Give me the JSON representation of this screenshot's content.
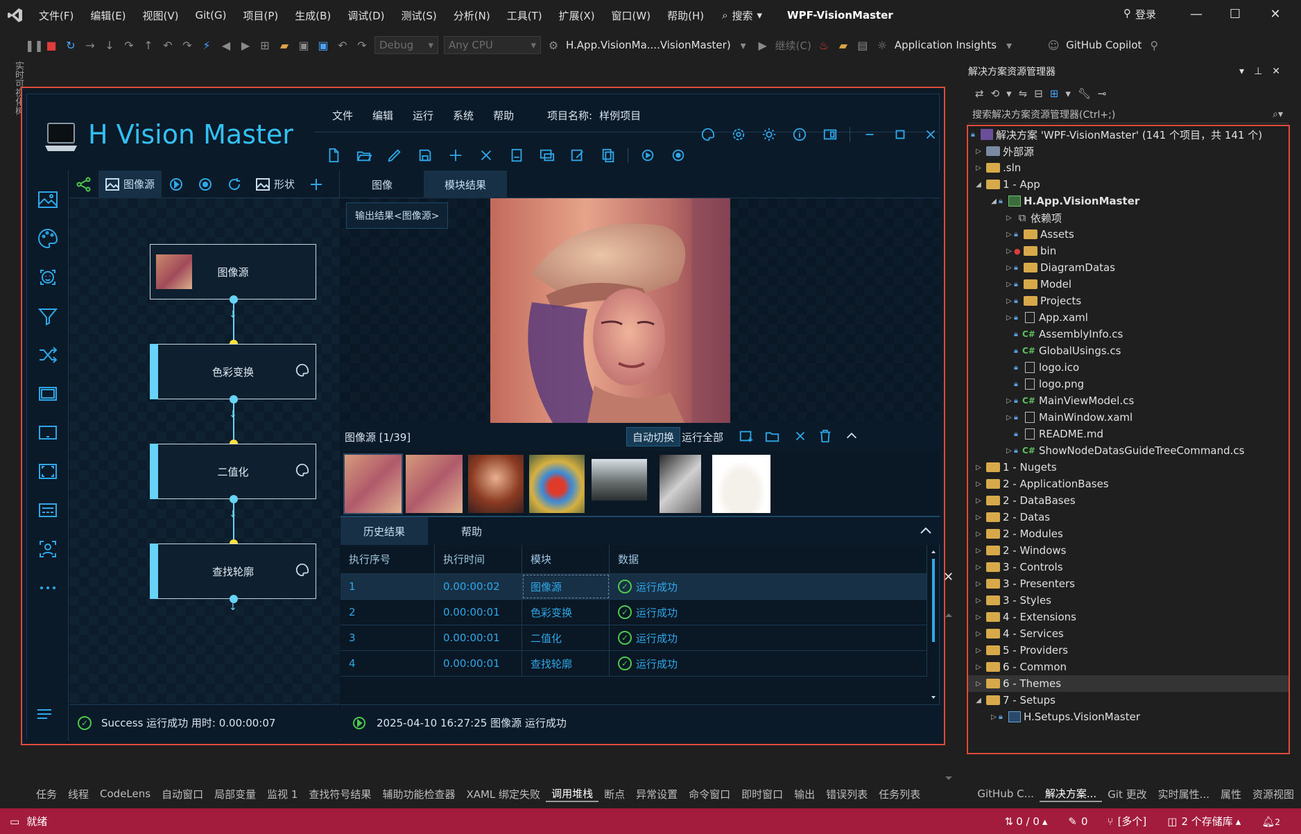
{
  "vs": {
    "menu": [
      "文件(F)",
      "编辑(E)",
      "视图(V)",
      "Git(G)",
      "项目(P)",
      "生成(B)",
      "调试(D)",
      "测试(S)",
      "分析(N)",
      "工具(T)",
      "扩展(X)",
      "窗口(W)",
      "帮助(H)"
    ],
    "search_label": "搜索",
    "solution_name": "WPF-VisionMaster",
    "login_label": "登录",
    "toolbar": {
      "config": "Debug",
      "platform": "Any CPU",
      "startup": "H.App.VisionMa....VisionMaster)",
      "continue": "继续(C)",
      "insights": "Application Insights",
      "copilot": "GitHub Copilot"
    },
    "left_tab": "实时可视化树",
    "bottom_tabs": [
      "任务",
      "线程",
      "CodeLens",
      "自动窗口",
      "局部变量",
      "监视 1",
      "查找符号结果",
      "辅助功能检查器",
      "XAML 绑定失败",
      "调用堆栈",
      "断点",
      "异常设置",
      "命令窗口",
      "即时窗口",
      "输出",
      "错误列表",
      "任务列表"
    ],
    "bottom_right_tabs": [
      "GitHub C...",
      "解决方案...",
      "Git 更改",
      "实时属性...",
      "属性",
      "资源视图"
    ],
    "status": {
      "ready": "就绪",
      "sync": "0 / 0",
      "edits": "0",
      "branch": "[多个]",
      "repos": "2 个存储库",
      "notify": "2"
    }
  },
  "app": {
    "title": "H Vision Master",
    "menu": [
      "文件",
      "编辑",
      "运行",
      "系统",
      "帮助"
    ],
    "project_label": "项目名称:",
    "project_name": "样例项目",
    "flow_tabs": {
      "image_source": "图像源",
      "shape": "形状"
    },
    "nodes": [
      {
        "label": "图像源"
      },
      {
        "label": "色彩变换"
      },
      {
        "label": "二值化"
      },
      {
        "label": "查找轮廓"
      }
    ],
    "flow_status": "Success 运行成功 用时: 0.00:00:07",
    "image_tabs": [
      "图像",
      "模块结果"
    ],
    "output_button": "输出结果<图像源>",
    "thumb_label": "图像源 [1/39]",
    "auto_switch": "自动切换",
    "run_all": "运行全部",
    "history_tabs": [
      "历史结果",
      "帮助"
    ],
    "history_headers": [
      "执行序号",
      "执行时间",
      "模块",
      "数据"
    ],
    "history_rows": [
      {
        "no": "1",
        "time": "0.00:00:02",
        "module": "图像源",
        "data": "运行成功"
      },
      {
        "no": "2",
        "time": "0.00:00:01",
        "module": "色彩变换",
        "data": "运行成功"
      },
      {
        "no": "3",
        "time": "0.00:00:01",
        "module": "二值化",
        "data": "运行成功"
      },
      {
        "no": "4",
        "time": "0.00:00:01",
        "module": "查找轮廓",
        "data": "运行成功"
      }
    ],
    "right_status": "2025-04-10 16:27:25 图像源 运行成功"
  },
  "solution_explorer": {
    "title": "解决方案资源管理器",
    "search_placeholder": "搜索解决方案资源管理器(Ctrl+;)",
    "root": "解决方案 'WPF-VisionMaster' (141 个项目，共 141 个)",
    "items": [
      {
        "label": "外部源"
      },
      {
        "label": ".sln"
      },
      {
        "label": "1 - App"
      },
      {
        "label": "H.App.VisionMaster"
      },
      {
        "label": "依赖项"
      },
      {
        "label": "Assets"
      },
      {
        "label": "bin"
      },
      {
        "label": "DiagramDatas"
      },
      {
        "label": "Model"
      },
      {
        "label": "Projects"
      },
      {
        "label": "App.xaml"
      },
      {
        "label": "AssemblyInfo.cs"
      },
      {
        "label": "GlobalUsings.cs"
      },
      {
        "label": "logo.ico"
      },
      {
        "label": "logo.png"
      },
      {
        "label": "MainViewModel.cs"
      },
      {
        "label": "MainWindow.xaml"
      },
      {
        "label": "README.md"
      },
      {
        "label": "ShowNodeDatasGuideTreeCommand.cs"
      },
      {
        "label": "1 - Nugets"
      },
      {
        "label": "2 - ApplicationBases"
      },
      {
        "label": "2 - DataBases"
      },
      {
        "label": "2 - Datas"
      },
      {
        "label": "2 - Modules"
      },
      {
        "label": "2 - Windows"
      },
      {
        "label": "3 - Controls"
      },
      {
        "label": "3 - Presenters"
      },
      {
        "label": "3 - Styles"
      },
      {
        "label": "4 - Extensions"
      },
      {
        "label": "4 - Services"
      },
      {
        "label": "5 - Providers"
      },
      {
        "label": "6 - Common"
      },
      {
        "label": "6 - Themes"
      },
      {
        "label": "7 - Setups"
      },
      {
        "label": "H.Setups.VisionMaster"
      }
    ]
  },
  "colors": {
    "accent": "#2ea8e8",
    "title": "#33c0f5",
    "status_bar": "#a31c3d",
    "highlight_border": "#e04a3b",
    "success": "#4cc94c"
  }
}
